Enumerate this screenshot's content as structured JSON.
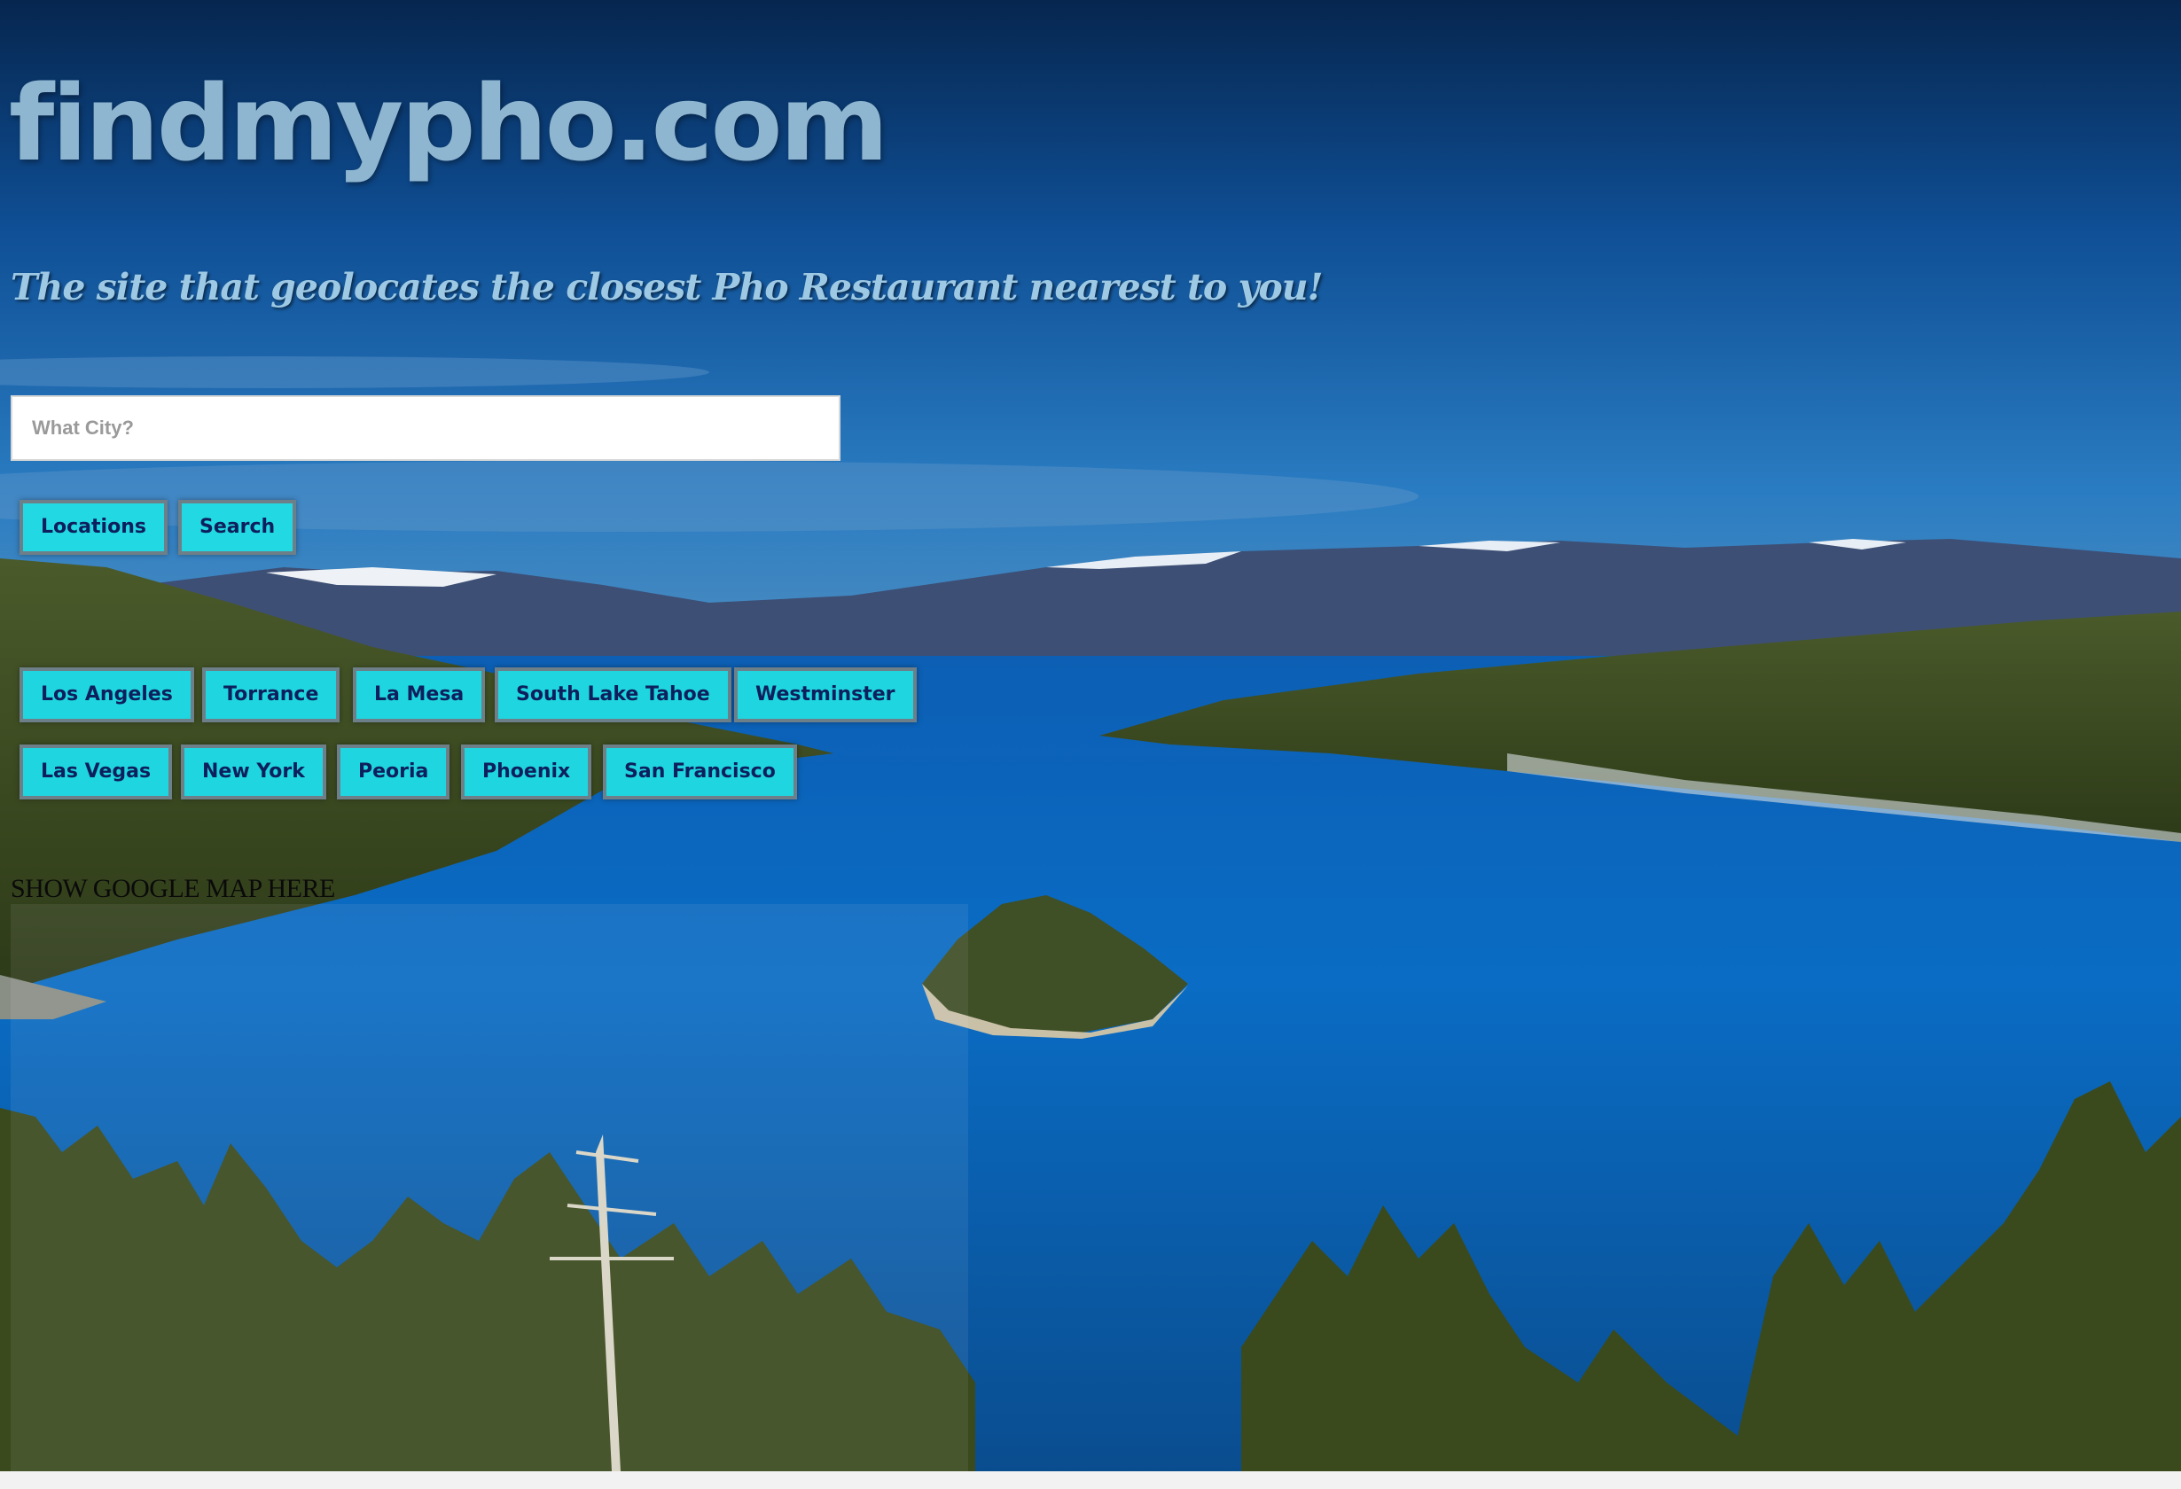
{
  "header": {
    "site_title": "findmypho.com",
    "tagline": "The site that geolocates the closest Pho Restaurant nearest to you!"
  },
  "search": {
    "placeholder": "What City?",
    "value": ""
  },
  "actions": {
    "locations_label": "Locations",
    "search_label": "Search"
  },
  "cities": [
    "Los Angeles",
    "Torrance",
    "La Mesa",
    "South Lake Tahoe",
    "Westminster",
    "Las Vegas",
    "New York",
    "Peoria",
    "Phoenix",
    "San Francisco"
  ],
  "map": {
    "placeholder_text": "SHOW GOOGLE MAP HERE"
  },
  "colors": {
    "button_bg": "#22d9e3",
    "button_text": "#0d1f5c",
    "title": "#8fb6d1",
    "tagline": "#9ec9e4"
  }
}
